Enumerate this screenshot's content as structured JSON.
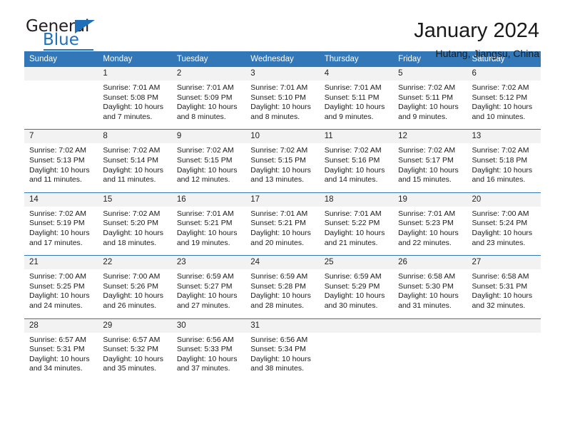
{
  "logo": {
    "part1": "General",
    "part2": "Blue",
    "triangle_color": "#1f70b8"
  },
  "header": {
    "title": "January 2024",
    "subtitle": "Hutang, Jiangsu, China"
  },
  "theme": {
    "header_blue": "#3277b8",
    "daynum_gray": "#f2f2f2",
    "text": "#1a1a1a"
  },
  "calendar": {
    "weekday_headers": [
      "Sunday",
      "Monday",
      "Tuesday",
      "Wednesday",
      "Thursday",
      "Friday",
      "Saturday"
    ],
    "weeks": [
      [
        {
          "day": "",
          "lines": []
        },
        {
          "day": "1",
          "lines": [
            "Sunrise: 7:01 AM",
            "Sunset: 5:08 PM",
            "Daylight: 10 hours",
            "and 7 minutes."
          ]
        },
        {
          "day": "2",
          "lines": [
            "Sunrise: 7:01 AM",
            "Sunset: 5:09 PM",
            "Daylight: 10 hours",
            "and 8 minutes."
          ]
        },
        {
          "day": "3",
          "lines": [
            "Sunrise: 7:01 AM",
            "Sunset: 5:10 PM",
            "Daylight: 10 hours",
            "and 8 minutes."
          ]
        },
        {
          "day": "4",
          "lines": [
            "Sunrise: 7:01 AM",
            "Sunset: 5:11 PM",
            "Daylight: 10 hours",
            "and 9 minutes."
          ]
        },
        {
          "day": "5",
          "lines": [
            "Sunrise: 7:02 AM",
            "Sunset: 5:11 PM",
            "Daylight: 10 hours",
            "and 9 minutes."
          ]
        },
        {
          "day": "6",
          "lines": [
            "Sunrise: 7:02 AM",
            "Sunset: 5:12 PM",
            "Daylight: 10 hours",
            "and 10 minutes."
          ]
        }
      ],
      [
        {
          "day": "7",
          "lines": [
            "Sunrise: 7:02 AM",
            "Sunset: 5:13 PM",
            "Daylight: 10 hours",
            "and 11 minutes."
          ]
        },
        {
          "day": "8",
          "lines": [
            "Sunrise: 7:02 AM",
            "Sunset: 5:14 PM",
            "Daylight: 10 hours",
            "and 11 minutes."
          ]
        },
        {
          "day": "9",
          "lines": [
            "Sunrise: 7:02 AM",
            "Sunset: 5:15 PM",
            "Daylight: 10 hours",
            "and 12 minutes."
          ]
        },
        {
          "day": "10",
          "lines": [
            "Sunrise: 7:02 AM",
            "Sunset: 5:15 PM",
            "Daylight: 10 hours",
            "and 13 minutes."
          ]
        },
        {
          "day": "11",
          "lines": [
            "Sunrise: 7:02 AM",
            "Sunset: 5:16 PM",
            "Daylight: 10 hours",
            "and 14 minutes."
          ]
        },
        {
          "day": "12",
          "lines": [
            "Sunrise: 7:02 AM",
            "Sunset: 5:17 PM",
            "Daylight: 10 hours",
            "and 15 minutes."
          ]
        },
        {
          "day": "13",
          "lines": [
            "Sunrise: 7:02 AM",
            "Sunset: 5:18 PM",
            "Daylight: 10 hours",
            "and 16 minutes."
          ]
        }
      ],
      [
        {
          "day": "14",
          "lines": [
            "Sunrise: 7:02 AM",
            "Sunset: 5:19 PM",
            "Daylight: 10 hours",
            "and 17 minutes."
          ]
        },
        {
          "day": "15",
          "lines": [
            "Sunrise: 7:02 AM",
            "Sunset: 5:20 PM",
            "Daylight: 10 hours",
            "and 18 minutes."
          ]
        },
        {
          "day": "16",
          "lines": [
            "Sunrise: 7:01 AM",
            "Sunset: 5:21 PM",
            "Daylight: 10 hours",
            "and 19 minutes."
          ]
        },
        {
          "day": "17",
          "lines": [
            "Sunrise: 7:01 AM",
            "Sunset: 5:21 PM",
            "Daylight: 10 hours",
            "and 20 minutes."
          ]
        },
        {
          "day": "18",
          "lines": [
            "Sunrise: 7:01 AM",
            "Sunset: 5:22 PM",
            "Daylight: 10 hours",
            "and 21 minutes."
          ]
        },
        {
          "day": "19",
          "lines": [
            "Sunrise: 7:01 AM",
            "Sunset: 5:23 PM",
            "Daylight: 10 hours",
            "and 22 minutes."
          ]
        },
        {
          "day": "20",
          "lines": [
            "Sunrise: 7:00 AM",
            "Sunset: 5:24 PM",
            "Daylight: 10 hours",
            "and 23 minutes."
          ]
        }
      ],
      [
        {
          "day": "21",
          "lines": [
            "Sunrise: 7:00 AM",
            "Sunset: 5:25 PM",
            "Daylight: 10 hours",
            "and 24 minutes."
          ]
        },
        {
          "day": "22",
          "lines": [
            "Sunrise: 7:00 AM",
            "Sunset: 5:26 PM",
            "Daylight: 10 hours",
            "and 26 minutes."
          ]
        },
        {
          "day": "23",
          "lines": [
            "Sunrise: 6:59 AM",
            "Sunset: 5:27 PM",
            "Daylight: 10 hours",
            "and 27 minutes."
          ]
        },
        {
          "day": "24",
          "lines": [
            "Sunrise: 6:59 AM",
            "Sunset: 5:28 PM",
            "Daylight: 10 hours",
            "and 28 minutes."
          ]
        },
        {
          "day": "25",
          "lines": [
            "Sunrise: 6:59 AM",
            "Sunset: 5:29 PM",
            "Daylight: 10 hours",
            "and 30 minutes."
          ]
        },
        {
          "day": "26",
          "lines": [
            "Sunrise: 6:58 AM",
            "Sunset: 5:30 PM",
            "Daylight: 10 hours",
            "and 31 minutes."
          ]
        },
        {
          "day": "27",
          "lines": [
            "Sunrise: 6:58 AM",
            "Sunset: 5:31 PM",
            "Daylight: 10 hours",
            "and 32 minutes."
          ]
        }
      ],
      [
        {
          "day": "28",
          "lines": [
            "Sunrise: 6:57 AM",
            "Sunset: 5:31 PM",
            "Daylight: 10 hours",
            "and 34 minutes."
          ]
        },
        {
          "day": "29",
          "lines": [
            "Sunrise: 6:57 AM",
            "Sunset: 5:32 PM",
            "Daylight: 10 hours",
            "and 35 minutes."
          ]
        },
        {
          "day": "30",
          "lines": [
            "Sunrise: 6:56 AM",
            "Sunset: 5:33 PM",
            "Daylight: 10 hours",
            "and 37 minutes."
          ]
        },
        {
          "day": "31",
          "lines": [
            "Sunrise: 6:56 AM",
            "Sunset: 5:34 PM",
            "Daylight: 10 hours",
            "and 38 minutes."
          ]
        },
        {
          "day": "",
          "lines": []
        },
        {
          "day": "",
          "lines": []
        },
        {
          "day": "",
          "lines": []
        }
      ]
    ]
  }
}
